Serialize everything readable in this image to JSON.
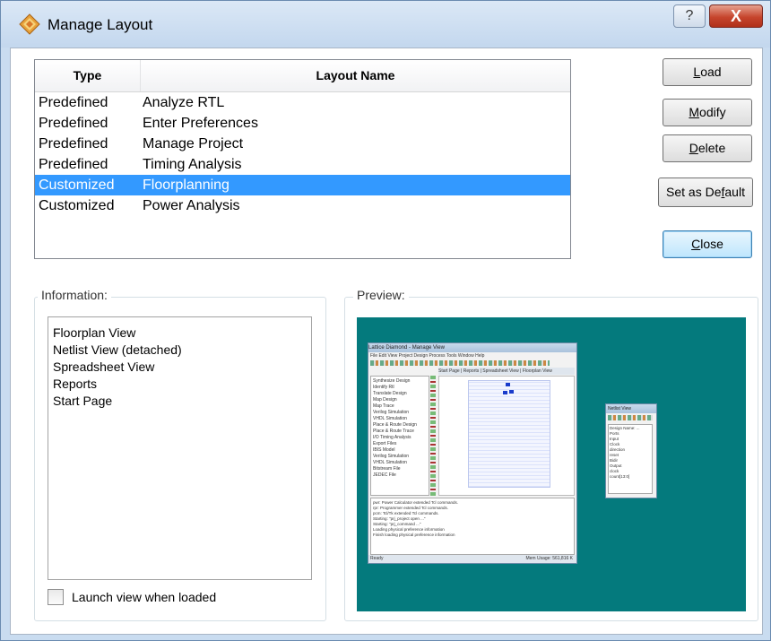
{
  "window": {
    "title": "Manage Layout",
    "help_glyph": "?",
    "close_glyph": "X"
  },
  "table": {
    "columns": [
      "Type",
      "Layout Name"
    ],
    "rows": [
      {
        "type": "Predefined",
        "name": "Analyze RTL"
      },
      {
        "type": "Predefined",
        "name": "Enter Preferences"
      },
      {
        "type": "Predefined",
        "name": "Manage Project"
      },
      {
        "type": "Predefined",
        "name": "Timing Analysis"
      },
      {
        "type": "Customized",
        "name": "Floorplanning"
      },
      {
        "type": "Customized",
        "name": "Power Analysis"
      }
    ],
    "selected_index": 4
  },
  "buttons": {
    "load": {
      "accel": "L",
      "rest": "oad"
    },
    "modify": {
      "accel": "M",
      "rest": "odify"
    },
    "delete": {
      "accel": "D",
      "rest": "elete"
    },
    "set_default": {
      "pre": "Set as De",
      "accel": "f",
      "rest": "ault"
    },
    "close": {
      "accel": "C",
      "rest": "lose"
    }
  },
  "information": {
    "label": "Information:",
    "items": [
      "Floorplan View",
      "Netlist View (detached)",
      "Spreadsheet View",
      "Reports",
      "Start Page"
    ]
  },
  "launch_checkbox": {
    "label": "Launch view when loaded",
    "checked": false
  },
  "preview": {
    "label": "Preview:",
    "background": "#047a7d",
    "main_title": "Lattice Diamond - Manage View",
    "menu": "File  Edit  View  Project  Design  Process  Tools  Window  Help",
    "tabs": "Start Page  |  Reports  |  Spreadsheet View  |  Floorplan View",
    "tree": [
      "Synthesize Design",
      "Identify Rtl",
      "Translate Design",
      "Map Design",
      "Map Trace",
      "Verilog Simulation",
      "VHDL Simulation",
      "Place & Route Design",
      "Place & Route Trace",
      "I/O Timing Analysis",
      "Export Files",
      "IBIS Model",
      "Verilog Simulation",
      "VHDL Simulation",
      "Bitstream File",
      "JEDEC File"
    ],
    "console": [
      "pwr: Power Calculator extended Tcl commands.",
      "rpr: Programmer extended Tcl commands.",
      "pcm: Tcl/Tk extended Tcl commands.",
      "Starting: \"prj_project open ...\"",
      "Starting: \"prj_command ...\"",
      "Loading physical preference information",
      "Finish loading physical preference information"
    ],
    "status": "Ready",
    "status_right": "Mem Usage: 561,816 K",
    "netlist_title": "Netlist View",
    "netlist_tree": [
      "Design Name: ...",
      "Ports",
      "Input",
      "Clock",
      "direction",
      "reset",
      "Bidir",
      "Output",
      "clock",
      "count[13:0]"
    ]
  }
}
